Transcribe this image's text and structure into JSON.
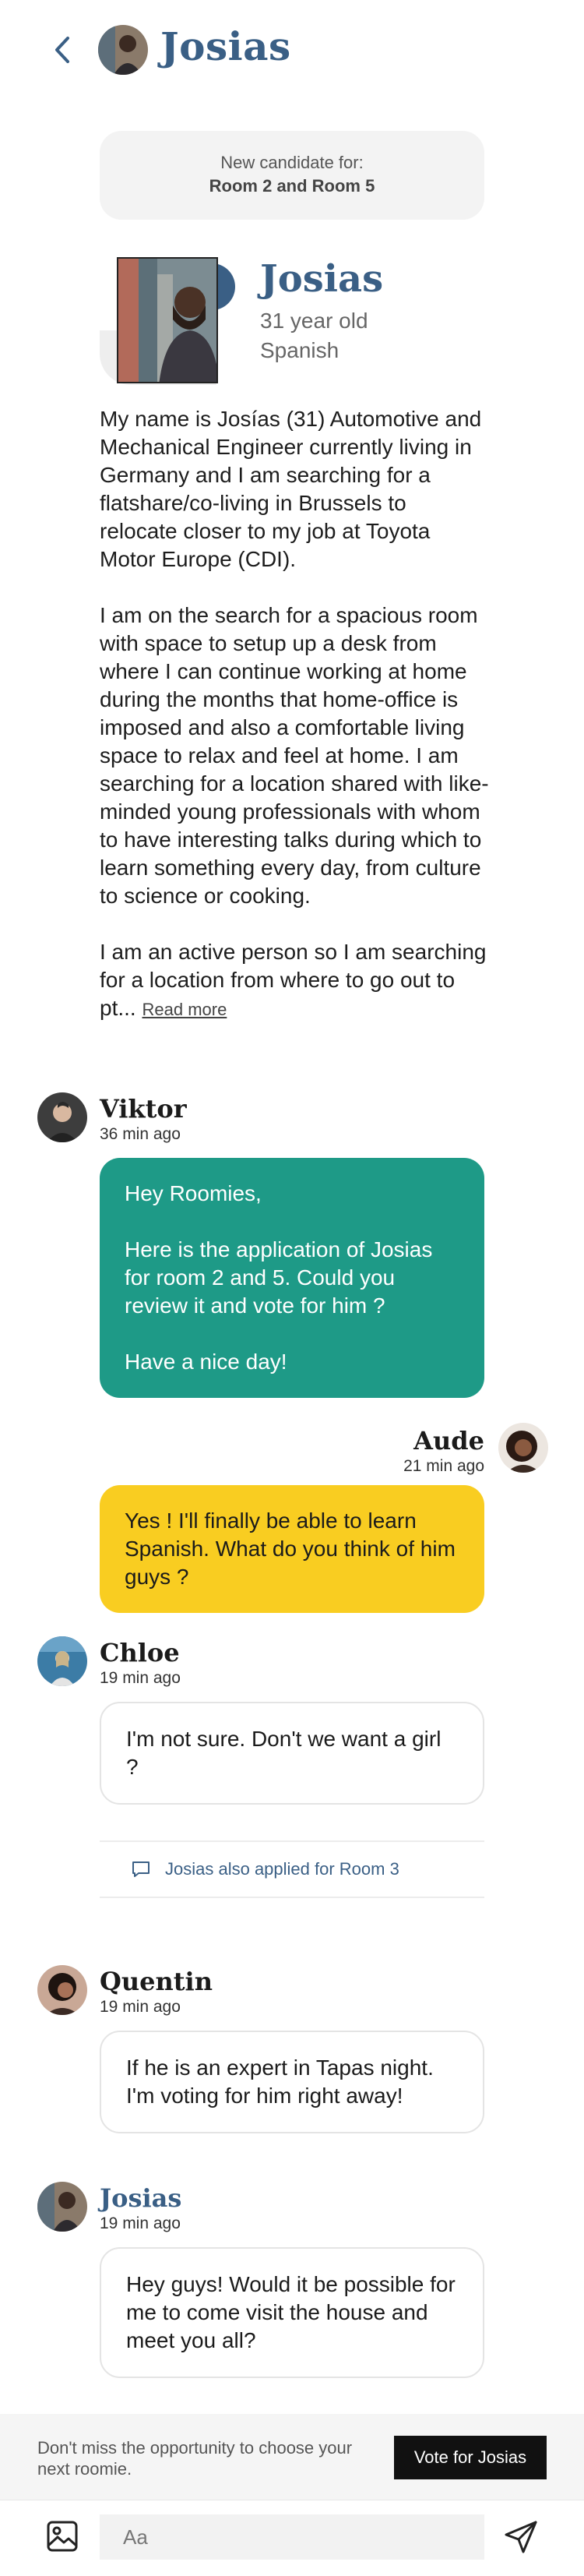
{
  "header": {
    "title": "Josias",
    "back_icon": "chevron-left-icon"
  },
  "notice": {
    "line1": "New candidate for:",
    "line2": "Room 2 and Room 5"
  },
  "candidate": {
    "name": "Josias",
    "age": "31 year old",
    "nationality": "Spanish",
    "bio": [
      "My name is Josías (31) Automotive and Mechanical Engineer currently living in Germany and I am searching for a flatshare/co-living in Brussels to relocate closer to my job at Toyota Motor Europe (CDI).",
      "I am on the search for a spacious room with space to setup up a desk from where I can continue working at home during the months that home-office is imposed and also a comfortable living space to relax and feel at home. I am searching for a location shared with like-minded young professionals with whom to have interesting talks during which to learn something every day, from culture to science or cooking.",
      "I am an active person so I am searching for a location from where to go out to pt..."
    ],
    "read_more": "Read more"
  },
  "messages": [
    {
      "sender": "Viktor",
      "time": "36 min ago",
      "text": "Hey Roomies,\n\nHere is the application of Josias for room 2 and 5. Could you review it and vote for him ?\n\nHave a nice day!"
    },
    {
      "sender": "Aude",
      "time": "21 min ago",
      "text": "Yes ! I'll finally be able to learn Spanish. What do you think of him guys ?"
    },
    {
      "sender": "Chloe",
      "time": "19 min ago",
      "text": "I'm not sure. Don't we want a girl ?"
    },
    {
      "sender": "Quentin",
      "time": "19 min ago",
      "text": "If he is an expert in Tapas night. I'm voting for him right away!"
    },
    {
      "sender": "Josias",
      "time": "19 min ago",
      "text": "Hey guys! Would it be possible for me to come visit the house and meet you all?"
    }
  ],
  "applied_notice": "Josias also applied for Room 3",
  "vote": {
    "text": "Don't miss the opportunity to choose your next roomie.",
    "button": "Vote for Josias"
  },
  "composer": {
    "placeholder": "Aa",
    "image_icon": "image-icon",
    "send_icon": "send-icon"
  },
  "colors": {
    "accent": "#3a5f85",
    "green_bubble": "#1e9a87",
    "yellow_bubble": "#f9cd21"
  }
}
